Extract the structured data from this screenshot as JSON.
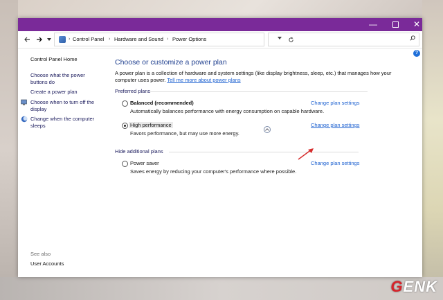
{
  "window": {
    "min_glyph": "—",
    "close_glyph": "✕"
  },
  "addressbar": {
    "breadcrumbs": [
      "Control Panel",
      "Hardware and Sound",
      "Power Options"
    ],
    "search_placeholder": ""
  },
  "sidebar": {
    "home": "Control Panel Home",
    "links": [
      "Choose what the power buttons do",
      "Create a power plan",
      "Choose when to turn off the display",
      "Change when the computer sleeps"
    ],
    "see_also_label": "See also",
    "see_also_items": [
      "User Accounts"
    ]
  },
  "main": {
    "title": "Choose or customize a power plan",
    "intro": "A power plan is a collection of hardware and system settings (like display brightness, sleep, etc.) that manages how your computer uses power.",
    "intro_link": "Tell me more about power plans",
    "preferred_heading": "Preferred plans",
    "hide_additional_heading": "Hide additional plans",
    "plans": [
      {
        "name": "Balanced (recommended)",
        "description": "Automatically balances performance with energy consumption on capable hardware.",
        "link": "Change plan settings",
        "selected": false
      },
      {
        "name": "High performance",
        "description": "Favors performance, but may use more energy.",
        "link": "Change plan settings",
        "selected": true
      },
      {
        "name": "Power saver",
        "description": "Saves energy by reducing your computer's performance where possible.",
        "link": "Change plan settings",
        "selected": false
      }
    ]
  },
  "watermark": {
    "brand_first": "G",
    "brand_rest": "ENK"
  },
  "colors": {
    "titlebar": "#7a2a99",
    "title_text": "#1f3f8f",
    "link": "#1a5fd0",
    "arrow": "#d62b2b"
  }
}
